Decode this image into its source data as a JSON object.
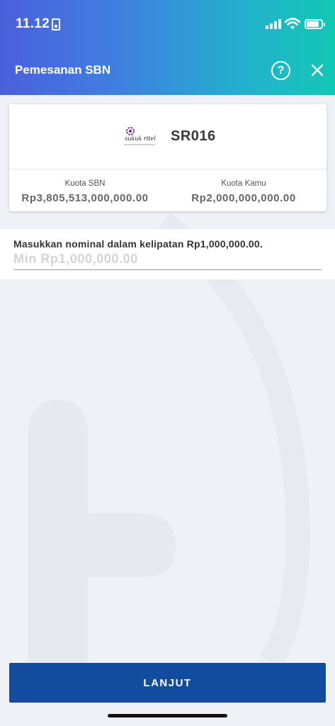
{
  "status_bar": {
    "time": "11.12"
  },
  "header": {
    "title": "Pemesanan SBN",
    "help_label": "?"
  },
  "card": {
    "logo_text": "sukuk ritel",
    "product_code": "SR016",
    "quota_sbn": {
      "label": "Kuota SBN",
      "value": "Rp3,805,513,000,000.00"
    },
    "quota_user": {
      "label": "Kuota Kamu",
      "value": "Rp2,000,000,000.00"
    }
  },
  "form": {
    "label": "Masukkan nominal dalam kelipatan Rp1,000,000.00.",
    "placeholder": "Min Rp1,000,000.00",
    "value": ""
  },
  "footer": {
    "next_label": "LANJUT"
  },
  "icons": {
    "help": "help-icon",
    "close": "close-icon",
    "signal": "signal-icon",
    "wifi": "wifi-icon",
    "battery": "battery-icon",
    "sim": "sim-icon",
    "logo": "sukuk-ritel-logo"
  },
  "colors": {
    "header_gradient_start": "#4b5fdc",
    "header_gradient_end": "#12c8b4",
    "button": "#124c9e",
    "background": "#eef1f5"
  }
}
